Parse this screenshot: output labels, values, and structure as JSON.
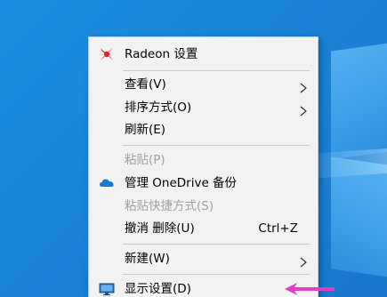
{
  "context_menu": {
    "items": [
      {
        "label": "Radeon 设置",
        "icon": "radeon-icon",
        "shortcut": "",
        "submenu": false,
        "disabled": false
      },
      {
        "label": "查看(V)",
        "icon": "",
        "shortcut": "",
        "submenu": true,
        "disabled": false
      },
      {
        "label": "排序方式(O)",
        "icon": "",
        "shortcut": "",
        "submenu": true,
        "disabled": false
      },
      {
        "label": "刷新(E)",
        "icon": "",
        "shortcut": "",
        "submenu": false,
        "disabled": false
      },
      {
        "label": "粘贴(P)",
        "icon": "",
        "shortcut": "",
        "submenu": false,
        "disabled": true
      },
      {
        "label": "管理 OneDrive 备份",
        "icon": "cloud-icon",
        "shortcut": "",
        "submenu": false,
        "disabled": false
      },
      {
        "label": "粘贴快捷方式(S)",
        "icon": "",
        "shortcut": "",
        "submenu": false,
        "disabled": true
      },
      {
        "label": "撤消 删除(U)",
        "icon": "",
        "shortcut": "Ctrl+Z",
        "submenu": false,
        "disabled": false
      },
      {
        "label": "新建(W)",
        "icon": "",
        "shortcut": "",
        "submenu": true,
        "disabled": false
      },
      {
        "label": "显示设置(D)",
        "icon": "display-icon",
        "shortcut": "",
        "submenu": false,
        "disabled": false
      }
    ]
  },
  "colors": {
    "desktop": "#1a83d6",
    "menu_bg": "#f2f2f2",
    "disabled_text": "#a0a0a0",
    "radeon_red": "#e3262e",
    "onedrive_blue": "#1479d0",
    "arrow_magenta": "#e040c8"
  }
}
